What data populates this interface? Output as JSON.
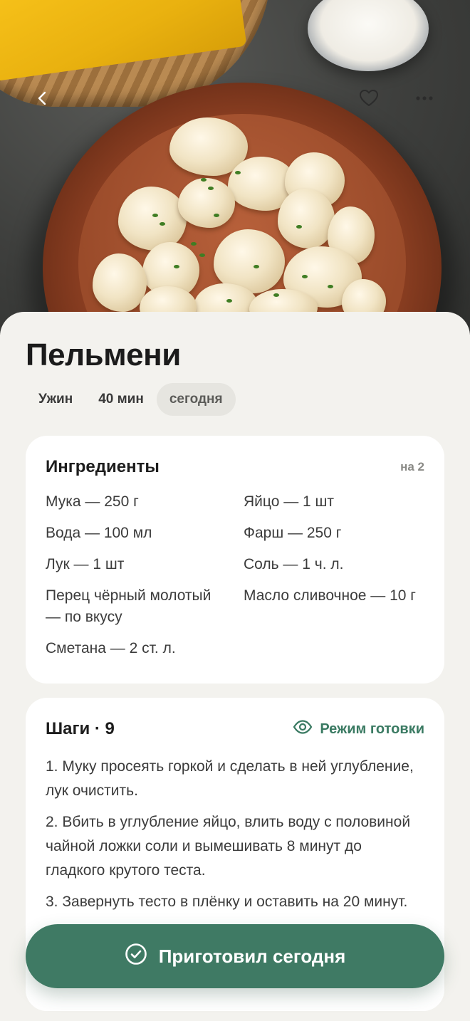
{
  "hero": {
    "icons": [
      "back-arrow-icon",
      "heart-icon",
      "more-dots-icon"
    ]
  },
  "recipe": {
    "title": "Пельмени",
    "meta": {
      "meal": "Ужин",
      "time": "40 мин",
      "when": "сегодня"
    }
  },
  "ingredients": {
    "title": "Ингредиенты",
    "serves": "на 2",
    "items": [
      "Мука — 250 г",
      "Яйцо — 1 шт",
      "Вода — 100 мл",
      "Фарш — 250 г",
      "Лук — 1 шт",
      "Соль — 1 ч. л.",
      "Перец чёрный молотый — по вкусу",
      "Масло сливочное — 10 г",
      "Сметана — 2 ст. л."
    ]
  },
  "steps": {
    "title": "Шаги · 9",
    "cook_mode_label": "Режим готовки",
    "items": [
      "1. Муку просеять горкой и сделать в ней углубление, лук очистить.",
      "2. Вбить в углубление яйцо, влить воду с половиной чайной ложки соли и вымешивать 8 минут до гладкого крутого теста.",
      "3. Завернуть тесто в плёнку и оставить на 20 минут."
    ]
  },
  "cta": {
    "label": "Приготовил сегодня"
  },
  "colors": {
    "accent": "#3f7a64",
    "background": "#f3f2ee",
    "card": "#ffffff"
  }
}
